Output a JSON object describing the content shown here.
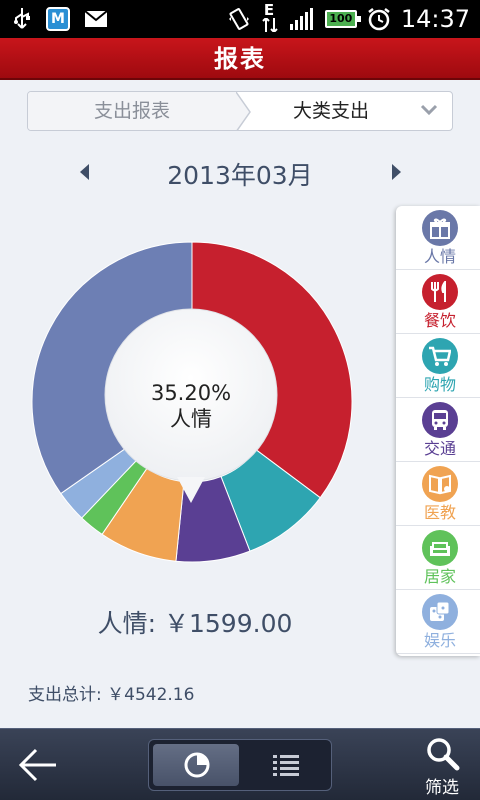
{
  "status_bar": {
    "left_icons": [
      "usb-icon",
      "app-m-icon",
      "mail-icon"
    ],
    "app_badge_letter": "M",
    "right_icons": [
      "vibrate-icon",
      "data-e-icon",
      "signal-icon",
      "battery-icon",
      "alarm-icon"
    ],
    "data_type": "E",
    "battery_level": "100",
    "time": "14:37"
  },
  "title_bar": {
    "title": "报表"
  },
  "selector": {
    "left_label": "支出报表",
    "right_label": "大类支出"
  },
  "month_nav": {
    "label": "2013年03月"
  },
  "chart_data": {
    "type": "pie",
    "style": "donut",
    "slices": [
      {
        "category": "人情",
        "percent": 35.2,
        "color": "#c6202e"
      },
      {
        "category": "teal",
        "percent": 8.9,
        "color": "#2ea5b1"
      },
      {
        "category": "purple",
        "percent": 7.5,
        "color": "#5a3f93"
      },
      {
        "category": "orange",
        "percent": 7.9,
        "color": "#f0a352"
      },
      {
        "category": "green",
        "percent": 2.6,
        "color": "#5fc25a"
      },
      {
        "category": "light-blue",
        "percent": 3.2,
        "color": "#8fb0de"
      },
      {
        "category": "slate",
        "percent": 34.7,
        "color": "#6d7fb4"
      }
    ],
    "center": {
      "percent_text": "35.20%",
      "category_text": "人情"
    }
  },
  "summary": {
    "amount_label": "人情:",
    "amount_value": "￥1599.00",
    "total_text": "支出总计: ￥4542.16"
  },
  "categories": [
    {
      "label": "人情",
      "icon": "gift-icon",
      "color": "#6a78a8"
    },
    {
      "label": "餐饮",
      "icon": "utensils-icon",
      "color": "#c6202e"
    },
    {
      "label": "购物",
      "icon": "cart-icon",
      "color": "#2ea5b1"
    },
    {
      "label": "交通",
      "icon": "bus-icon",
      "color": "#5a3f93"
    },
    {
      "label": "医教",
      "icon": "book-icon",
      "color": "#f0a352"
    },
    {
      "label": "居家",
      "icon": "sofa-icon",
      "color": "#5fc25a"
    },
    {
      "label": "娱乐",
      "icon": "dice-icon",
      "color": "#8fb0de"
    }
  ],
  "bottom_bar": {
    "filter_label": "筛选"
  }
}
